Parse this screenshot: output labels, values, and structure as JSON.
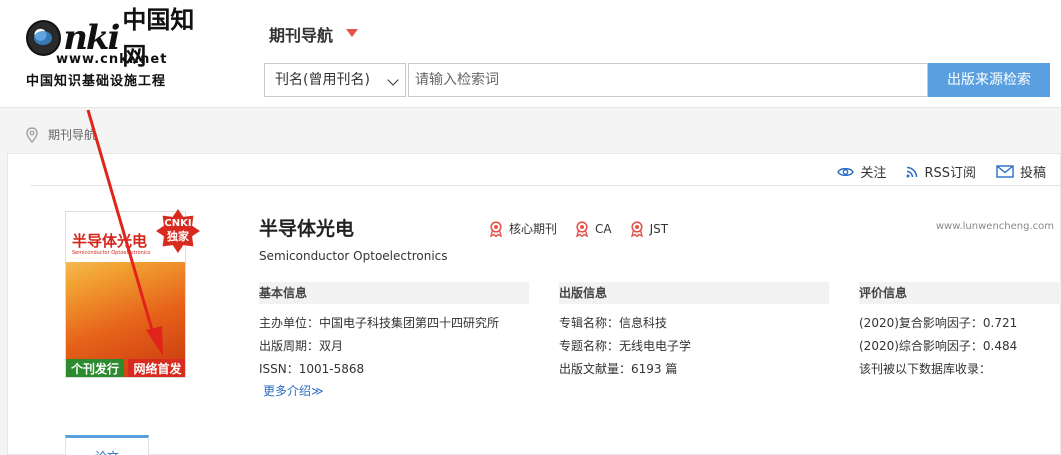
{
  "logo": {
    "brand_cn": "中国知网",
    "url": "www.cnki.net",
    "subtitle": "中国知识基础设施工程"
  },
  "nav": {
    "title": "期刊导航"
  },
  "search": {
    "field_select": "刊名(曾用刊名)",
    "placeholder": "请输入检索词",
    "button": "出版来源检索"
  },
  "breadcrumb": {
    "label": "期刊导航"
  },
  "actions": {
    "follow": "关注",
    "rss": "RSS订阅",
    "submit": "投稿"
  },
  "journal": {
    "title": "半导体光电",
    "english_title": "Semiconductor Optoelectronics",
    "tags": [
      "核心期刊",
      "CA",
      "JST"
    ],
    "watermark": "www.lunwencheng.com",
    "cover": {
      "title": "半导体光电",
      "band_left": "个刊发行",
      "band_right": "网络首发",
      "badge_line1": "CNKI",
      "badge_line2": "独家"
    }
  },
  "basic": {
    "heading": "基本信息",
    "rows": [
      "主办单位：中国电子科技集团第四十四研究所",
      "出版周期：双月",
      "ISSN：1001-5868"
    ],
    "more": "更多介绍≫"
  },
  "publish": {
    "heading": "出版信息",
    "rows": [
      "专辑名称：信息科技",
      "专题名称：无线电电子学",
      "出版文献量：6193 篇"
    ]
  },
  "evaluation": {
    "heading": "评价信息",
    "rows": [
      "(2020)复合影响因子：0.721",
      "(2020)综合影响因子：0.484",
      "该刊被以下数据库收录："
    ]
  },
  "tabs": {
    "first": "论文"
  },
  "colors": {
    "accent": "#5aa0e0",
    "red": "#d82a1e",
    "link": "#2b6dc4"
  }
}
